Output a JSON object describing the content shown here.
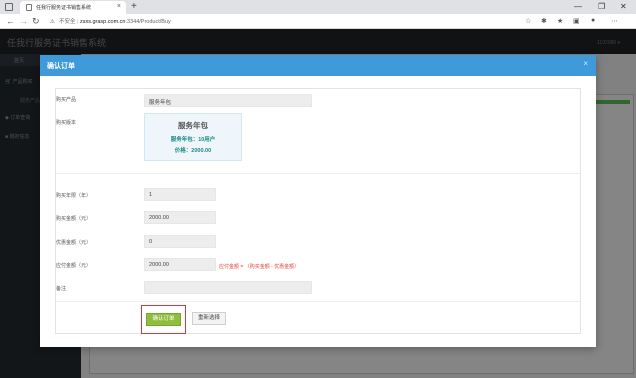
{
  "browser": {
    "tab_title": "任我行服务证书销售系统",
    "tab_close": "×",
    "new_tab": "+",
    "window_controls": [
      "—",
      "❐",
      "✕"
    ],
    "nav": {
      "back": "←",
      "forward": "→",
      "reload": "↻"
    },
    "url_security": "不安全",
    "url_host": "zsxs.grasp.com.cn",
    "url_path": ":3344/Product/Buy",
    "toolbar_icons": [
      "star-icon",
      "extensions-icon",
      "favorites-icon",
      "collections-icon",
      "profile-icon",
      "more-icon"
    ]
  },
  "app": {
    "title": "任我行服务证书销售系统",
    "user": "1102086 ▾"
  },
  "sidebar": {
    "items": [
      {
        "label": "首页"
      },
      {
        "label": "产品购买"
      },
      {
        "label": "订单查询"
      },
      {
        "label": "我的信息"
      }
    ],
    "sub_items": [
      {
        "label": "服务产品"
      }
    ]
  },
  "modal": {
    "title": "确认订单",
    "close": "×",
    "fields": {
      "product": {
        "label": "购买产品",
        "value": "服务年包"
      },
      "version": {
        "label": "购买版本"
      },
      "years": {
        "label": "购买年限（年）",
        "value": "1"
      },
      "amount": {
        "label": "购买金额（元）",
        "value": "2000.00"
      },
      "discount": {
        "label": "优惠金额（元）",
        "value": "0"
      },
      "payable": {
        "label": "应付金额（元）",
        "value": "2000.00",
        "hint": "应付金额 = （购买金额 - 优惠金额）"
      },
      "remark": {
        "label": "备注",
        "value": ""
      }
    },
    "version_card": {
      "title": "服务年包",
      "line1": "服务年包：10用户",
      "line2": "价格：2000.00"
    },
    "buttons": {
      "confirm": "确认订单",
      "reset": "重新选择"
    }
  },
  "colors": {
    "modal_header": "#3e9ad8",
    "confirm_button": "#8ebe3c",
    "highlight_border": "#d9363e",
    "hint_text": "#e0463f",
    "version_text": "#1a8a83"
  }
}
